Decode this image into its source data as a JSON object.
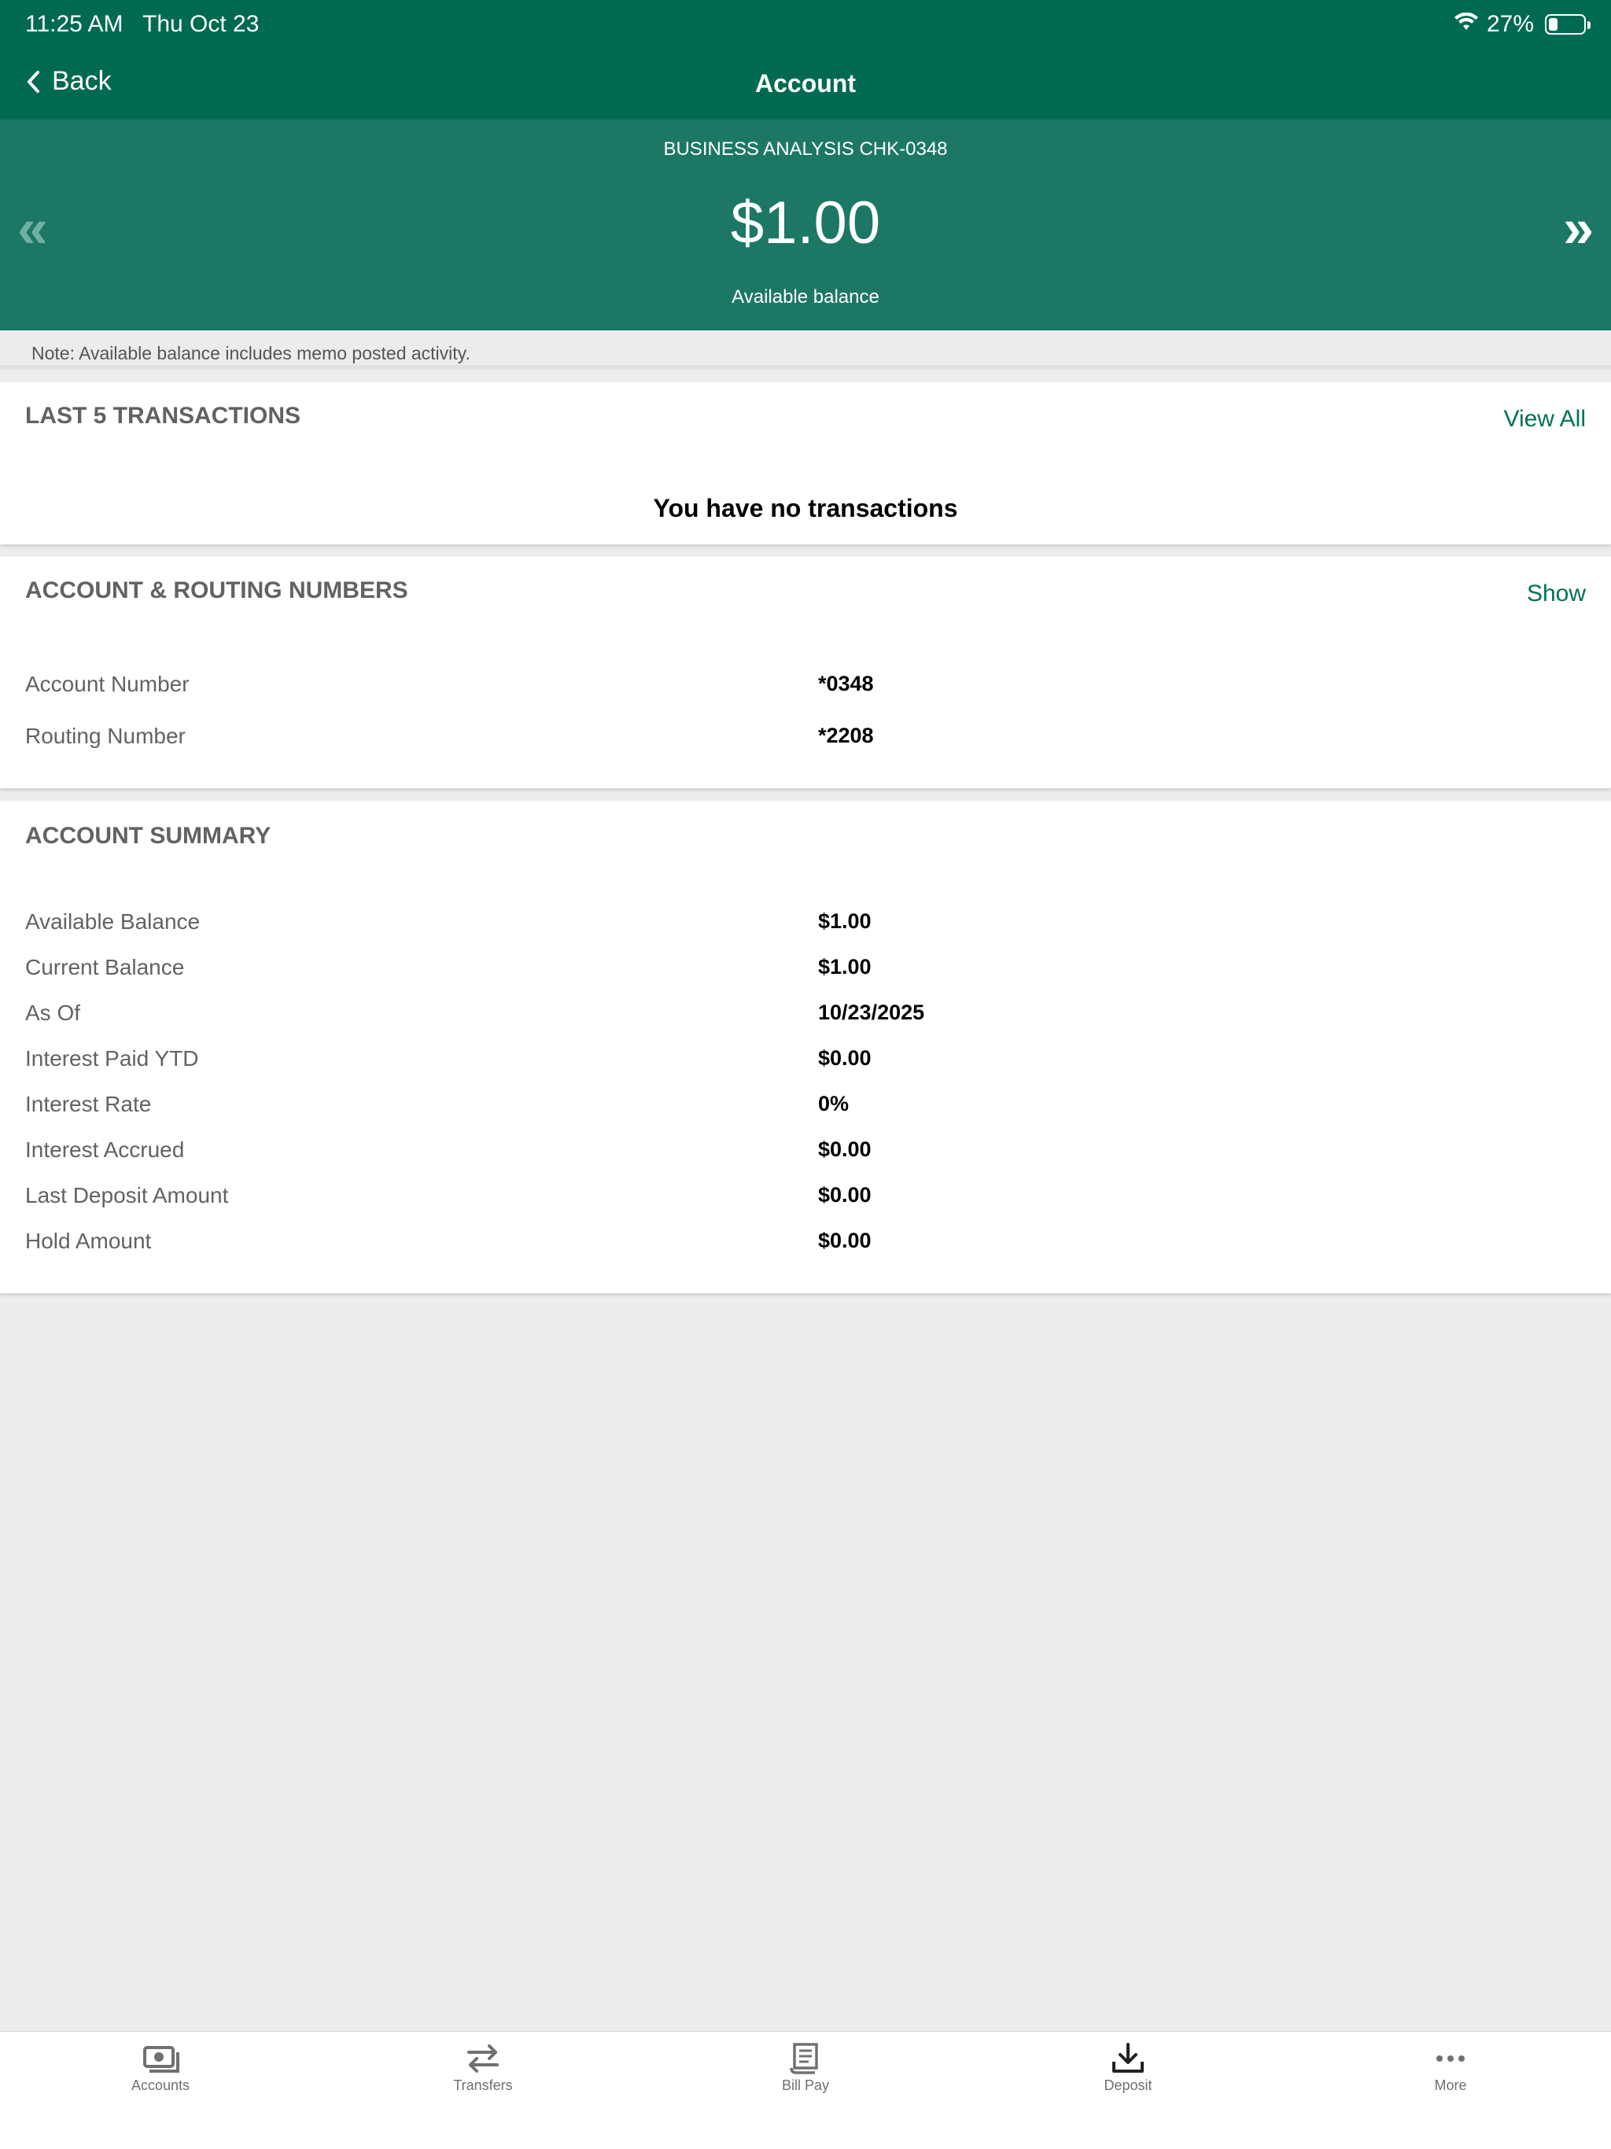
{
  "status_bar": {
    "time": "11:25 AM",
    "date": "Thu Oct 23",
    "battery_text": "27%",
    "battery_level": 0.27,
    "wifi_icon": "wifi-icon"
  },
  "nav": {
    "back_label": "Back",
    "title": "Account"
  },
  "hero": {
    "account_name": "BUSINESS ANALYSIS CHK-0348",
    "balance": "$1.00",
    "balance_label": "Available balance",
    "prev_glyph": "«",
    "next_glyph": "»"
  },
  "note": "Note: Available balance includes memo posted activity.",
  "transactions": {
    "title": "LAST 5 TRANSACTIONS",
    "view_all": "View All",
    "empty_message": "You have no transactions"
  },
  "routing": {
    "title": "ACCOUNT & ROUTING NUMBERS",
    "show_label": "Show",
    "rows": [
      {
        "label": "Account Number",
        "value": "*0348"
      },
      {
        "label": "Routing Number",
        "value": "*2208"
      }
    ]
  },
  "summary": {
    "title": "ACCOUNT SUMMARY",
    "rows": [
      {
        "label": "Available Balance",
        "value": "$1.00"
      },
      {
        "label": "Current Balance",
        "value": "$1.00"
      },
      {
        "label": "As Of",
        "value": "10/23/2025"
      },
      {
        "label": "Interest Paid YTD",
        "value": "$0.00"
      },
      {
        "label": "Interest Rate",
        "value": "0%"
      },
      {
        "label": "Interest Accrued",
        "value": "$0.00"
      },
      {
        "label": "Last Deposit Amount",
        "value": "$0.00"
      },
      {
        "label": "Hold Amount",
        "value": "$0.00"
      }
    ]
  },
  "tabs": [
    {
      "label": "Accounts",
      "icon": "accounts-icon"
    },
    {
      "label": "Transfers",
      "icon": "transfers-icon"
    },
    {
      "label": "Bill Pay",
      "icon": "bill-pay-icon"
    },
    {
      "label": "Deposit",
      "icon": "deposit-icon"
    },
    {
      "label": "More",
      "icon": "more-icon"
    }
  ],
  "colors": {
    "header": "#006a50",
    "hero": "#1c7864",
    "accent": "#007257",
    "background": "#ededed"
  }
}
